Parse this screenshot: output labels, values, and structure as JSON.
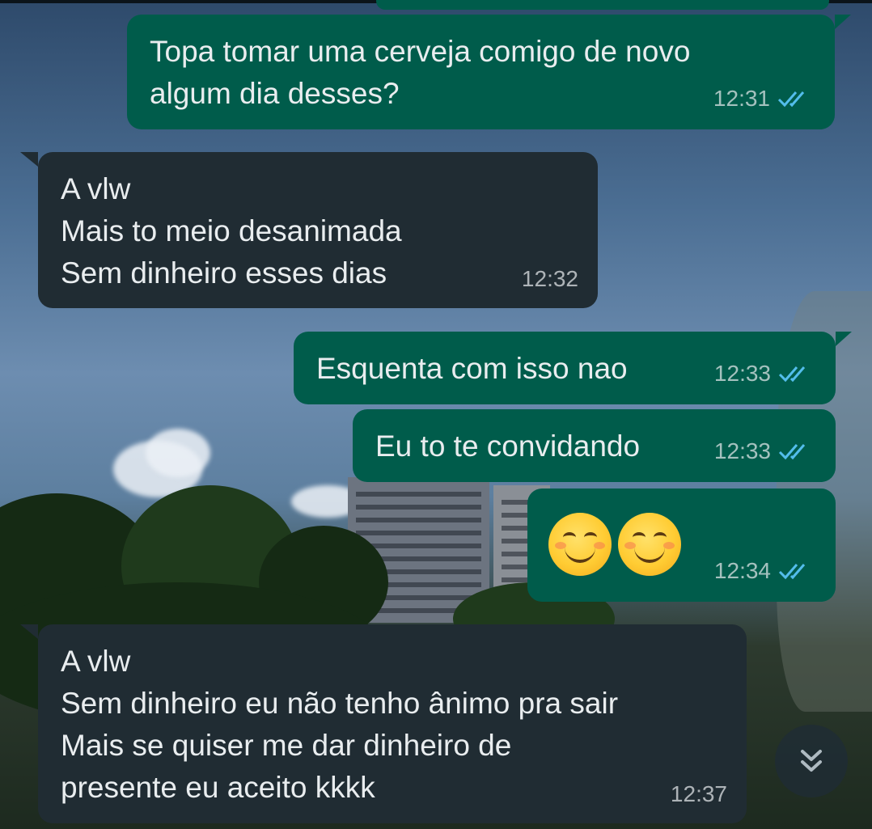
{
  "messages": [
    {
      "direction": "out",
      "text": "Topa tomar uma cerveja comigo de novo\nalgum dia desses?",
      "time": "12:31",
      "status": "read"
    },
    {
      "direction": "in",
      "text": "A vlw\nMais to meio desanimada\nSem dinheiro esses dias",
      "time": "12:32"
    },
    {
      "direction": "out",
      "text": "Esquenta com isso nao",
      "time": "12:33",
      "status": "read"
    },
    {
      "direction": "out",
      "text": "Eu to te convidando",
      "time": "12:33",
      "status": "read"
    },
    {
      "direction": "out",
      "emoji": [
        "smiling-face-with-smiling-eyes",
        "smiling-face-with-smiling-eyes"
      ],
      "time": "12:34",
      "status": "read"
    },
    {
      "direction": "in",
      "text": "A vlw\nSem dinheiro eu não tenho ânimo pra sair\nMais se quiser me dar dinheiro de\npresente eu aceito kkkk",
      "time": "12:37"
    }
  ],
  "colors": {
    "outgoing_bubble": "#005c4b",
    "incoming_bubble": "#202c33",
    "message_text": "#e9edef",
    "read_ticks": "#53bdeb"
  },
  "scroll_button_icon": "double-chevron-down-icon"
}
